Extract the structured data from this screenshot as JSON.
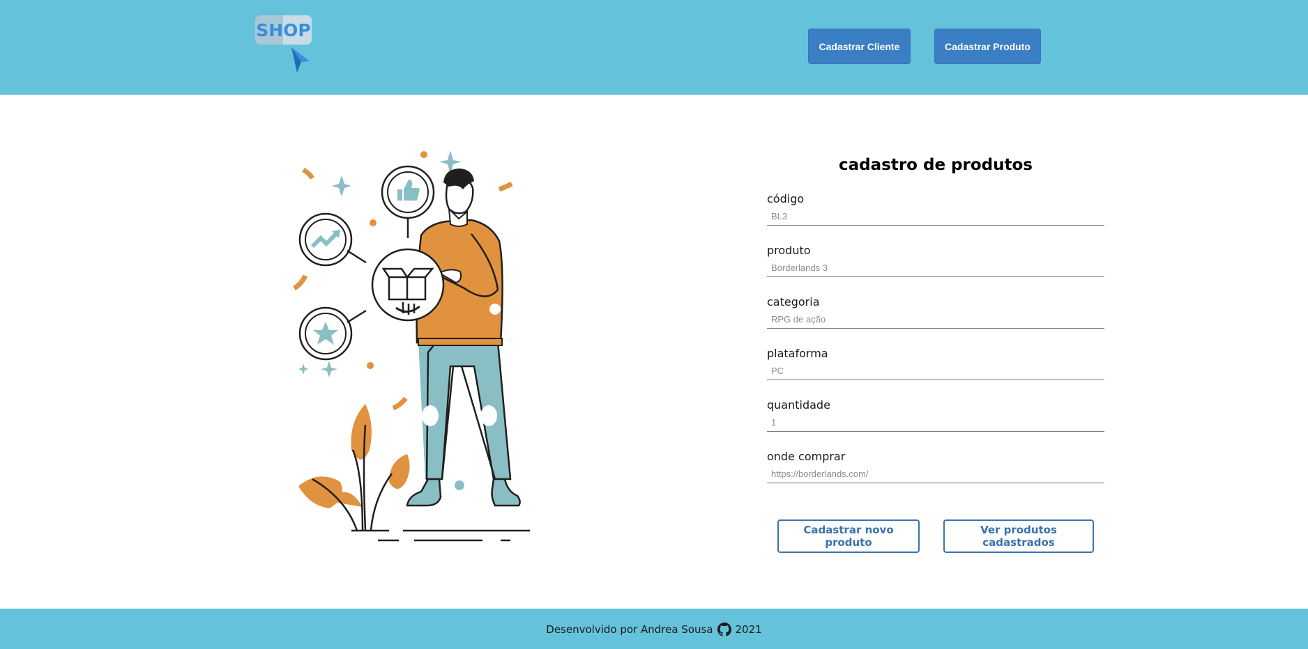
{
  "header": {
    "logo_text": "SHOP",
    "buttons": {
      "cliente": "Cadastrar Cliente",
      "produto": "Cadastrar Produto"
    },
    "colors": {
      "background": "#65c2db",
      "button": "#3a7ec4"
    }
  },
  "form": {
    "title": "cadastro de produtos",
    "fields": [
      {
        "label": "código",
        "placeholder": "BL3"
      },
      {
        "label": "produto",
        "placeholder": "Borderlands 3"
      },
      {
        "label": "categoria",
        "placeholder": "RPG de ação"
      },
      {
        "label": "plataforma",
        "placeholder": "PC"
      },
      {
        "label": "quantidade",
        "placeholder": "1"
      },
      {
        "label": "onde comprar",
        "placeholder": "https://borderlands.com/"
      }
    ],
    "buttons": {
      "novo": "Cadastrar novo produto",
      "ver": "Ver produtos cadastrados"
    },
    "colors": {
      "outline_button": "#3a72ad"
    }
  },
  "illustration": {
    "icons": [
      "thumbs-up-icon",
      "trend-up-icon",
      "star-icon",
      "box-icon"
    ],
    "colors": {
      "orange": "#e0923f",
      "teal": "#89bfc4",
      "ink": "#1f1f1f"
    }
  },
  "footer": {
    "text_before": "Desenvolvido por Andrea Sousa",
    "icon": "github-icon",
    "year": "2021"
  }
}
